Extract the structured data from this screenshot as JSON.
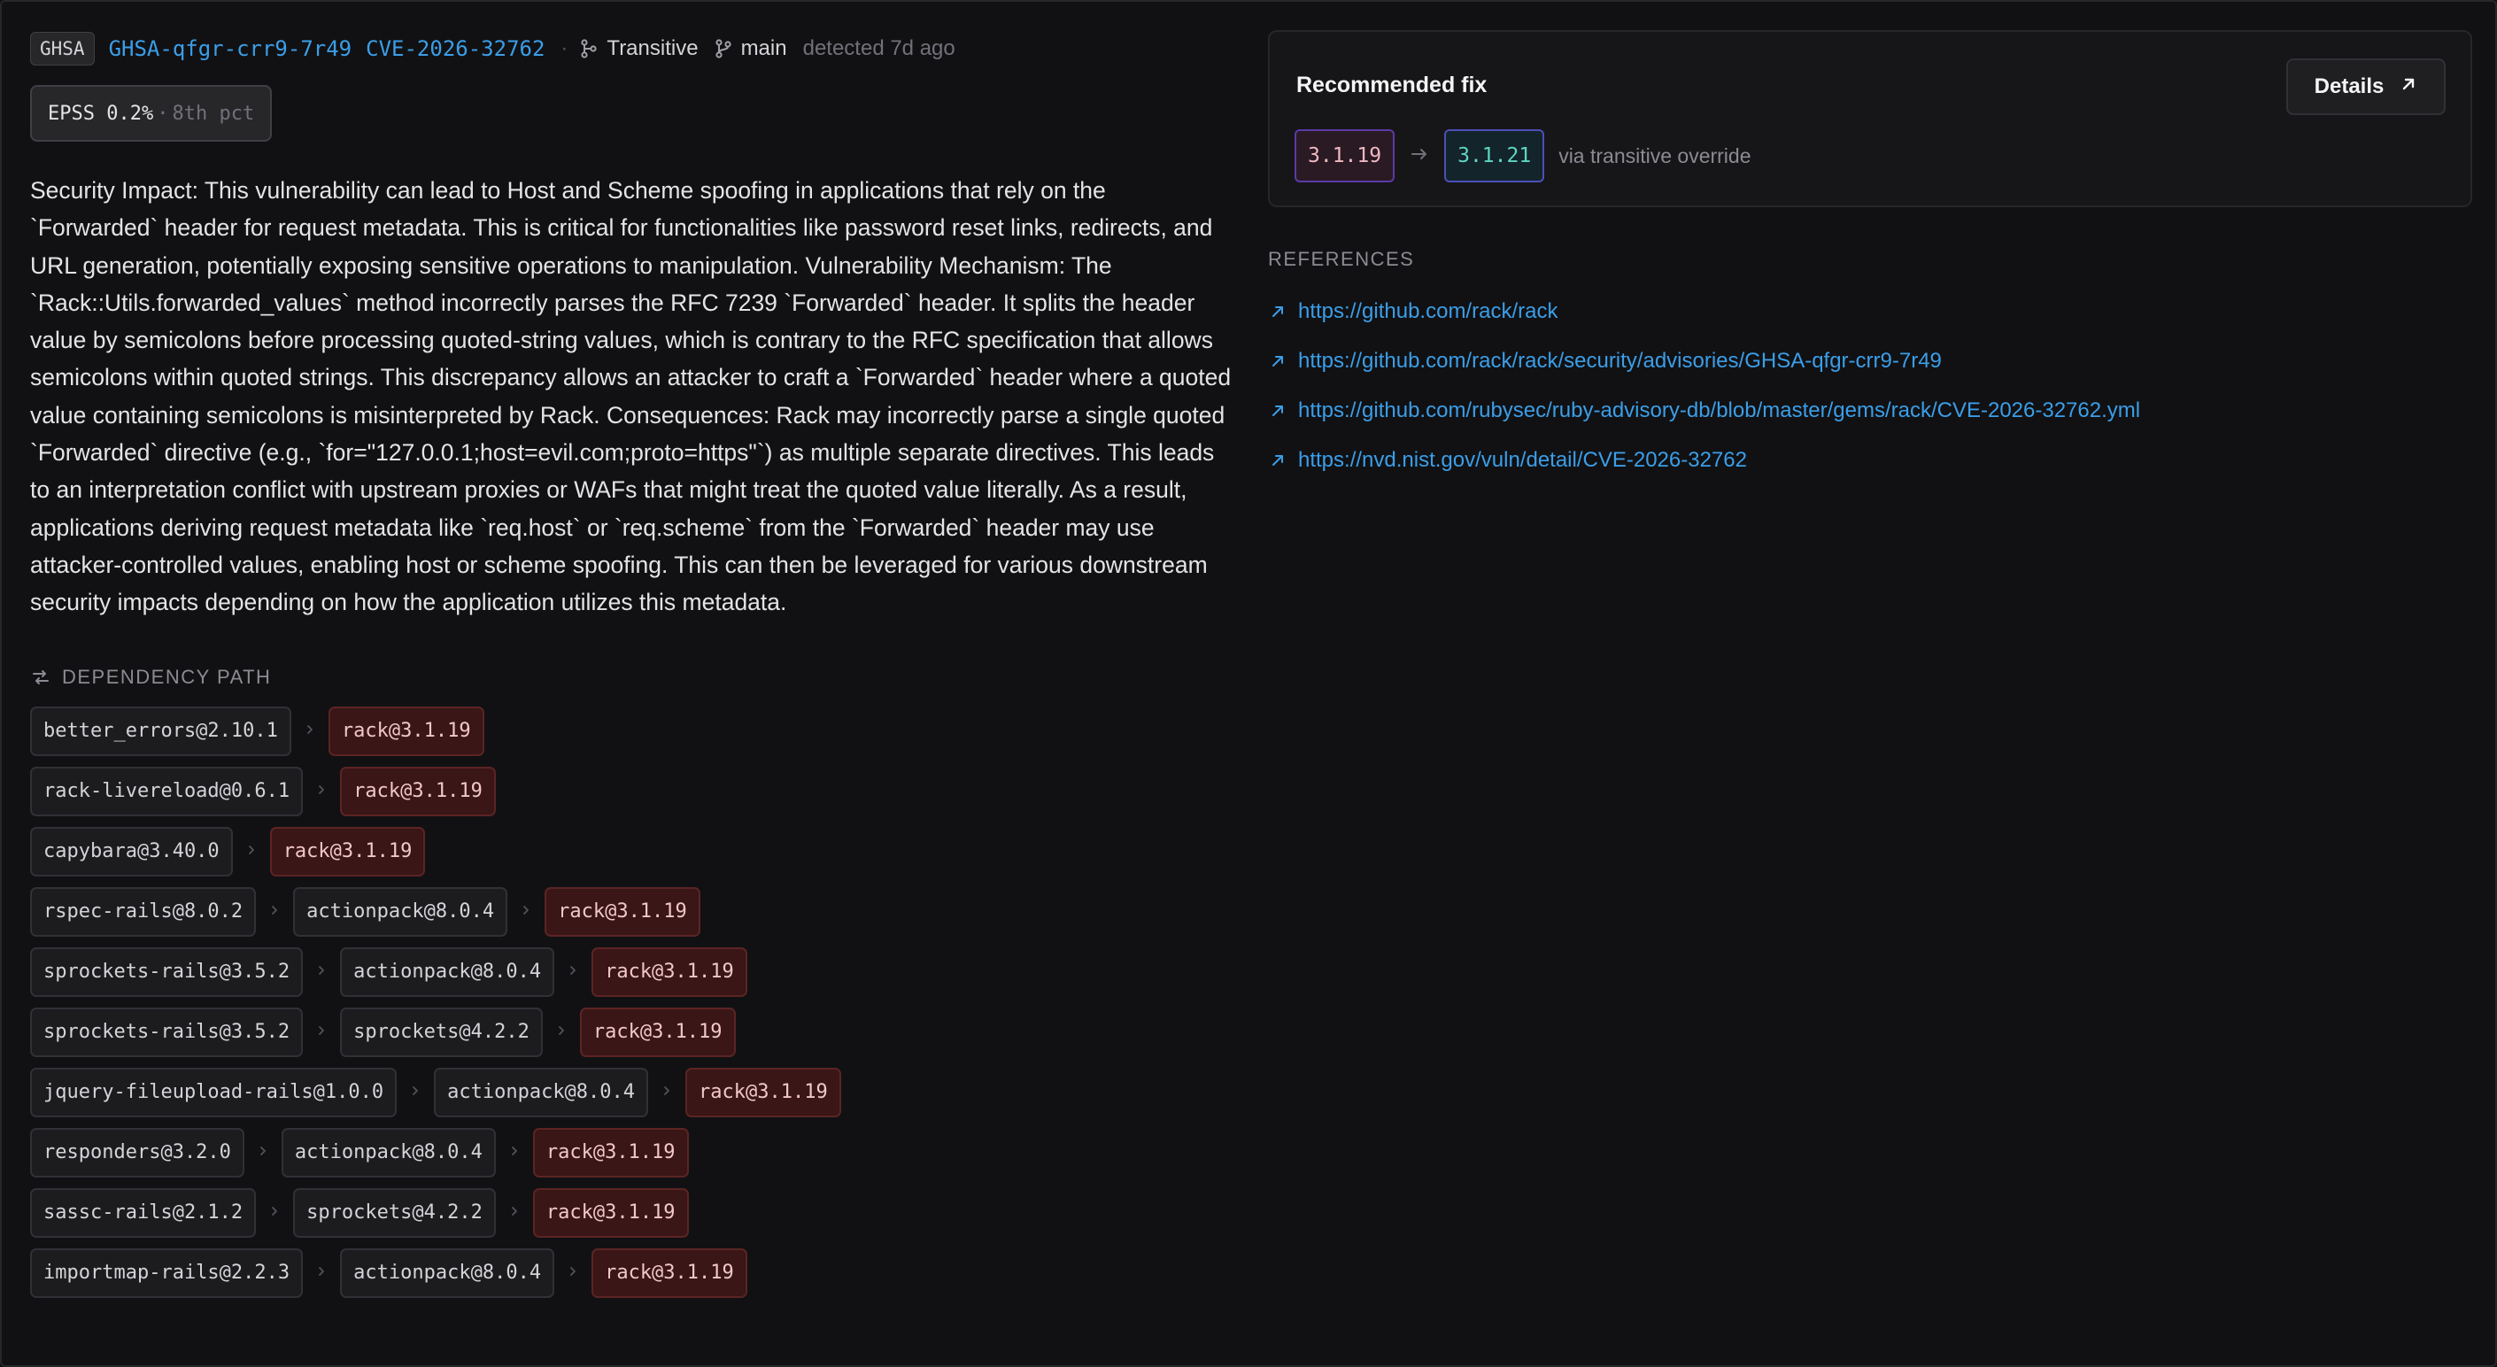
{
  "header": {
    "source_badge": "GHSA",
    "ghsa_id": "GHSA-qfgr-crr9-7r49",
    "cve_id": "CVE-2026-32762",
    "separator": "·",
    "dependency_type": "Transitive",
    "branch": "main",
    "detected": "detected 7d ago"
  },
  "epss": {
    "value": "EPSS 0.2%",
    "separator": "·",
    "percentile": "8th pct"
  },
  "description": "Security Impact: This vulnerability can lead to Host and Scheme spoofing in applications that rely on the `Forwarded` header for request metadata. This is critical for functionalities like password reset links, redirects, and URL generation, potentially exposing sensitive operations to manipulation. Vulnerability Mechanism: The `Rack::Utils.forwarded_values` method incorrectly parses the RFC 7239 `Forwarded` header. It splits the header value by semicolons before processing quoted-string values, which is contrary to the RFC specification that allows semicolons within quoted strings. This discrepancy allows an attacker to craft a `Forwarded` header where a quoted value containing semicolons is misinterpreted by Rack. Consequences: Rack may incorrectly parse a single quoted `Forwarded` directive (e.g., `for=\"127.0.0.1;host=evil.com;proto=https\"`) as multiple separate directives. This leads to an interpretation conflict with upstream proxies or WAFs that might treat the quoted value literally. As a result, applications deriving request metadata like `req.host` or `req.scheme` from the `Forwarded` header may use attacker-controlled values, enabling host or scheme spoofing. This can then be leveraged for various downstream security impacts depending on how the application utilizes this metadata.",
  "dependency_path": {
    "heading": "DEPENDENCY PATH",
    "vulnerable": "rack@3.1.19",
    "paths": [
      [
        "better_errors@2.10.1",
        "rack@3.1.19"
      ],
      [
        "rack-livereload@0.6.1",
        "rack@3.1.19"
      ],
      [
        "capybara@3.40.0",
        "rack@3.1.19"
      ],
      [
        "rspec-rails@8.0.2",
        "actionpack@8.0.4",
        "rack@3.1.19"
      ],
      [
        "sprockets-rails@3.5.2",
        "actionpack@8.0.4",
        "rack@3.1.19"
      ],
      [
        "sprockets-rails@3.5.2",
        "sprockets@4.2.2",
        "rack@3.1.19"
      ],
      [
        "jquery-fileupload-rails@1.0.0",
        "actionpack@8.0.4",
        "rack@3.1.19"
      ],
      [
        "responders@3.2.0",
        "actionpack@8.0.4",
        "rack@3.1.19"
      ],
      [
        "sassc-rails@2.1.2",
        "sprockets@4.2.2",
        "rack@3.1.19"
      ],
      [
        "importmap-rails@2.2.3",
        "actionpack@8.0.4",
        "rack@3.1.19"
      ]
    ]
  },
  "fix": {
    "title": "Recommended fix",
    "details_label": "Details",
    "from_version": "3.1.19",
    "to_version": "3.1.21",
    "via": "via transitive override"
  },
  "references": {
    "heading": "REFERENCES",
    "links": [
      "https://github.com/rack/rack",
      "https://github.com/rack/rack/security/advisories/GHSA-qfgr-crr9-7r49",
      "https://github.com/rubysec/ruby-advisory-db/blob/master/gems/rack/CVE-2026-32762.yml",
      "https://nvd.nist.gov/vuln/detail/CVE-2026-32762"
    ]
  },
  "icons": {
    "branch": "git-branch-icon",
    "transitive": "git-commit-graph-icon",
    "dependency": "dependency-path-icon",
    "details": "arrow-up-right-icon",
    "fix_arrow": "arrow-right-icon",
    "ref": "external-link-arrow-icon",
    "chevron": "chevron-right-icon"
  },
  "colors": {
    "background": "#111113",
    "link": "#3b9ee8",
    "vulnerable_chip": "#3a1616",
    "fixed_version": "#5fd6c4"
  }
}
